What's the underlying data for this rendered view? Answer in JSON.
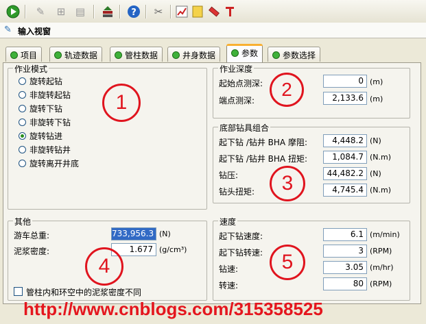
{
  "toolbar": {
    "icons": [
      "run-icon",
      "pin-icon",
      "tree-icon",
      "list-icon",
      "stack-icon",
      "help-icon",
      "tool-icon",
      "chart-icon",
      "note-icon",
      "ruler-icon",
      "drill-icon"
    ]
  },
  "window": {
    "title": "输入视窗"
  },
  "tabs": [
    {
      "label": "项目"
    },
    {
      "label": "轨迹数据"
    },
    {
      "label": "管柱数据"
    },
    {
      "label": "井身数据"
    },
    {
      "label": "参数",
      "active": true
    },
    {
      "label": "参数选择"
    }
  ],
  "mode_group": {
    "title": "作业模式",
    "options": [
      "旋转起钻",
      "非旋转起钻",
      "旋转下钻",
      "非旋转下钻",
      "旋转钻进",
      "非旋转钻井",
      "旋转离开井底"
    ],
    "selected": "旋转钻进"
  },
  "depth_group": {
    "title": "作业深度",
    "fields": [
      {
        "label": "起始点测深:",
        "value": "0",
        "unit": "(m)"
      },
      {
        "label": "端点测深:",
        "value": "2,133.6",
        "unit": "(m)"
      }
    ]
  },
  "bha_group": {
    "title": "底部钻具组合",
    "fields": [
      {
        "label": "起下钻 /钻井 BHA 摩阻:",
        "value": "4,448.2",
        "unit": "(N)"
      },
      {
        "label": "起下钻 /钻井 BHA 扭矩:",
        "value": "1,084.7",
        "unit": "(N.m)"
      },
      {
        "label": "钻压:",
        "value": "44,482.2",
        "unit": "(N)"
      },
      {
        "label": "钻头扭矩:",
        "value": "4,745.4",
        "unit": "(N.m)"
      }
    ]
  },
  "other_group": {
    "title": "其他",
    "fields": [
      {
        "label": "游车总重:",
        "value": "733,956.3",
        "unit": "(N)"
      },
      {
        "label": "泥浆密度:",
        "value": "1.677",
        "unit": "(g/cm³)"
      }
    ],
    "checkbox": "管柱内和环空中的泥浆密度不同"
  },
  "speed_group": {
    "title": "速度",
    "fields": [
      {
        "label": "起下钻速度:",
        "value": "6.1",
        "unit": "(m/min)"
      },
      {
        "label": "起下钻转速:",
        "value": "3",
        "unit": "(RPM)"
      },
      {
        "label": "钻速:",
        "value": "3.05",
        "unit": "(m/hr)"
      },
      {
        "label": "转速:",
        "value": "80",
        "unit": "(RPM)"
      }
    ]
  },
  "annotations": [
    "1",
    "2",
    "3",
    "4",
    "5"
  ],
  "watermark": "http://www.cnblogs.com/315358525",
  "colors": {
    "accent_red": "#e0141e",
    "tab_active_highlight": "#f9b032",
    "status_green": "#3fb13a"
  }
}
